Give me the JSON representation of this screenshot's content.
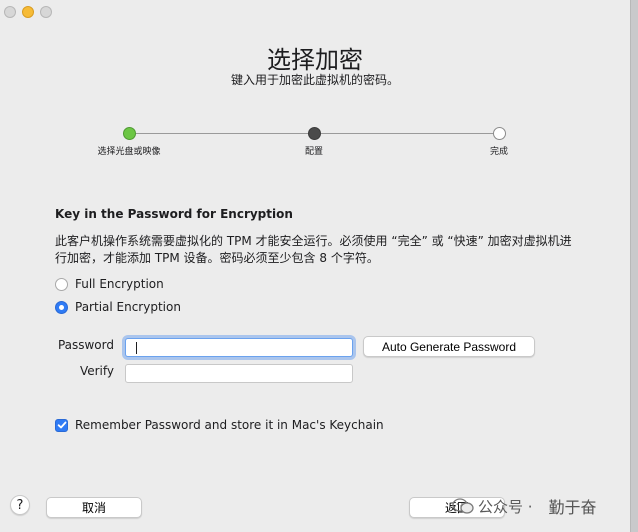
{
  "window": {
    "title": "选择加密",
    "subtitle": "键入用于加密此虚拟机的密码。"
  },
  "steps": [
    {
      "label": "选择光盘或映像",
      "state": "done"
    },
    {
      "label": "配置",
      "state": "current"
    },
    {
      "label": "完成",
      "state": "todo"
    }
  ],
  "colors": {
    "accent": "#2f7bf5",
    "step_done": "#6cc644",
    "step_current": "#4a4a4a"
  },
  "encryption": {
    "heading": "Key in the Password for Encryption",
    "description": "此客户机操作系统需要虚拟化的 TPM 才能安全运行。必须使用 “完全” 或 “快速” 加密对虚拟机进行加密，才能添加 TPM 设备。密码必须至少包含 8 个字符。",
    "options": [
      {
        "label": "Full Encryption",
        "selected": false
      },
      {
        "label": "Partial Encryption",
        "selected": true
      }
    ]
  },
  "form": {
    "password_label": "Password",
    "password_value": "",
    "verify_label": "Verify",
    "verify_value": "",
    "auto_generate_label": "Auto Generate Password"
  },
  "remember": {
    "label": "Remember Password and store it in Mac's Keychain",
    "checked": true
  },
  "footer": {
    "help_label": "?",
    "cancel_label": "取消",
    "back_label": "返回"
  },
  "watermark": {
    "text": "公众号 ·",
    "name": "勤于奋",
    "icon": "wechat-official-account-icon"
  }
}
